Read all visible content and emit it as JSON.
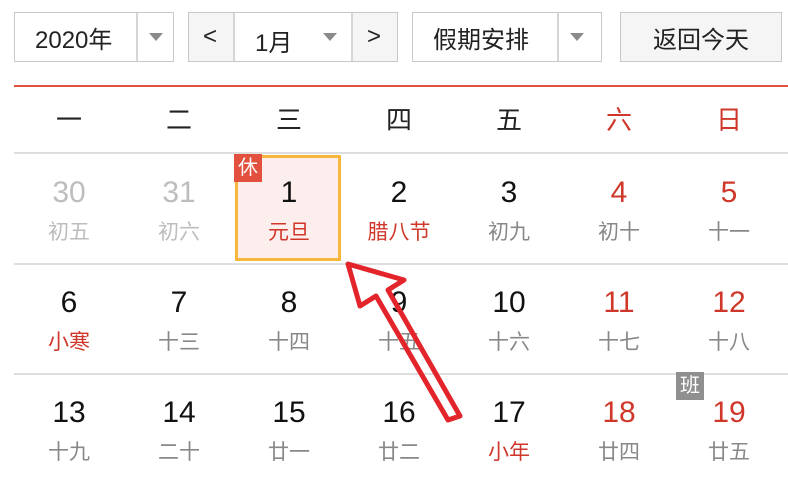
{
  "toolbar": {
    "year": "2020年",
    "month": "1月",
    "prev_label": "<",
    "next_label": ">",
    "holiday": "假期安排",
    "today_button": "返回今天"
  },
  "weekdays": [
    "一",
    "二",
    "三",
    "四",
    "五",
    "六",
    "日"
  ],
  "days": [
    {
      "num": "30",
      "sub": "初五"
    },
    {
      "num": "31",
      "sub": "初六"
    },
    {
      "num": "1",
      "sub": "元旦",
      "badge": "休"
    },
    {
      "num": "2",
      "sub": "腊八节"
    },
    {
      "num": "3",
      "sub": "初九"
    },
    {
      "num": "4",
      "sub": "初十"
    },
    {
      "num": "5",
      "sub": "十一"
    },
    {
      "num": "6",
      "sub": "小寒"
    },
    {
      "num": "7",
      "sub": "十三"
    },
    {
      "num": "8",
      "sub": "十四"
    },
    {
      "num": "9",
      "sub": "十五"
    },
    {
      "num": "10",
      "sub": "十六"
    },
    {
      "num": "11",
      "sub": "十七"
    },
    {
      "num": "12",
      "sub": "十八"
    },
    {
      "num": "13",
      "sub": "十九"
    },
    {
      "num": "14",
      "sub": "二十"
    },
    {
      "num": "15",
      "sub": "廿一"
    },
    {
      "num": "16",
      "sub": "廿二"
    },
    {
      "num": "17",
      "sub": "小年"
    },
    {
      "num": "18",
      "sub": "廿四"
    },
    {
      "num": "19",
      "sub": "廿五",
      "badge": "班"
    }
  ],
  "colors": {
    "accent_red": "#e4503e",
    "selected_border": "#f5b83d",
    "arrow": "#e3242b"
  }
}
